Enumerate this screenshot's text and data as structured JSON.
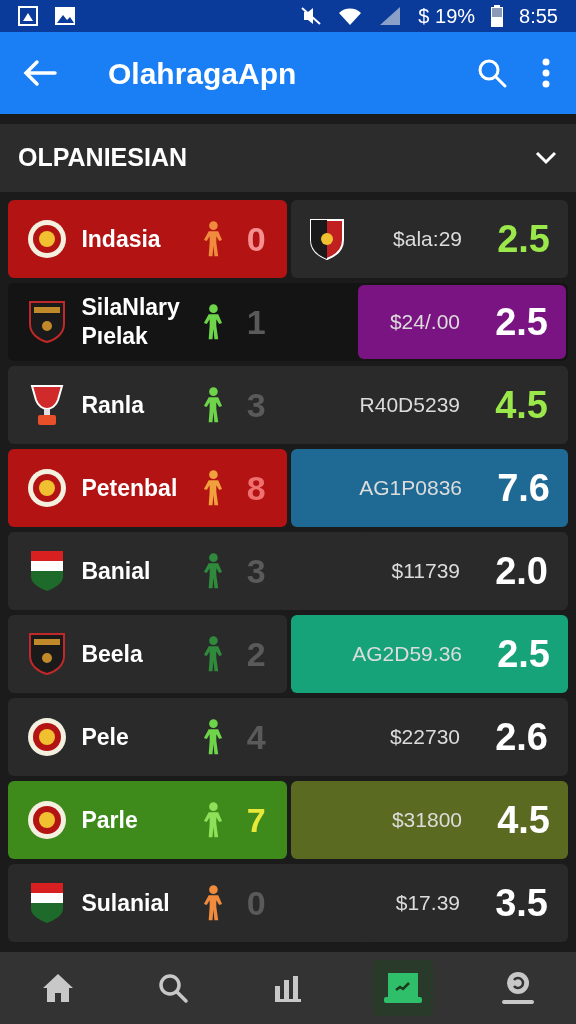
{
  "status_bar": {
    "battery": "$ 19%",
    "time": "8:55"
  },
  "app_bar": {
    "title": "OlahragaApn"
  },
  "section": {
    "title": "OLPANIESIAN"
  },
  "rows": [
    {
      "kind": "split",
      "crest": {
        "kind": "round"
      },
      "team": {
        "name": "Indasia",
        "color": "#b31313"
      },
      "player": {
        "color": "#f08a3c"
      },
      "score": {
        "text": "0",
        "color": "#f59090"
      },
      "odds": {
        "badge": {
          "kind": "shield"
        },
        "code": "$ala:29",
        "color": "#2a2a2a"
      },
      "value": {
        "text": "2.5",
        "color": "#9be84a"
      }
    },
    {
      "kind": "joined",
      "crest": {
        "kind": "shield"
      },
      "team": {
        "name": "SilaNlary Pıelak",
        "color": "#141414"
      },
      "player": {
        "color": "#6ed44a"
      },
      "score": {
        "text": "1",
        "color": "#5a5a5a"
      },
      "odds": {
        "code": "$24/.00",
        "color": "#7a1482"
      },
      "value": {
        "text": "2.5",
        "color": "#ffffff"
      }
    },
    {
      "kind": "joined",
      "crest": {
        "kind": "trophy"
      },
      "team": {
        "name": "Ranla",
        "color": "#2a2a2a"
      },
      "player": {
        "color": "#6ed44a"
      },
      "score": {
        "text": "3",
        "color": "#5a5a5a"
      },
      "odds": {
        "code": "R40D5239",
        "color": "#2a2a2a"
      },
      "value": {
        "text": "4.5",
        "color": "#9be84a"
      }
    },
    {
      "kind": "split",
      "crest": {
        "kind": "round"
      },
      "team": {
        "name": "Petenbal",
        "color": "#b31313"
      },
      "player": {
        "color": "#f0a03c"
      },
      "score": {
        "text": "8",
        "color": "#f07070"
      },
      "odds": {
        "code": "AG1P0836",
        "color": "#1f6a94"
      },
      "value": {
        "text": "7.6",
        "color": "#ffffff"
      }
    },
    {
      "kind": "joined",
      "crest": {
        "kind": "flag"
      },
      "team": {
        "name": "Banial",
        "color": "#2a2a2a"
      },
      "player": {
        "color": "#2f8a3c"
      },
      "score": {
        "text": "3",
        "color": "#5a5a5a"
      },
      "odds": {
        "code": "$11739",
        "color": "#2a2a2a"
      },
      "value": {
        "text": "2.0",
        "color": "#ffffff"
      }
    },
    {
      "kind": "split",
      "crest": {
        "kind": "shield"
      },
      "team": {
        "name": "Beela",
        "color": "#2a2a2a"
      },
      "player": {
        "color": "#2f8a3c"
      },
      "score": {
        "text": "2",
        "color": "#5a5a5a"
      },
      "odds": {
        "code": "AG2D59.36",
        "color": "#17a37a"
      },
      "value": {
        "text": "2.5",
        "color": "#ffffff"
      }
    },
    {
      "kind": "joined",
      "crest": {
        "kind": "round"
      },
      "team": {
        "name": "Pele",
        "color": "#2a2a2a"
      },
      "player": {
        "color": "#6ed44a"
      },
      "score": {
        "text": "4",
        "color": "#5a5a5a"
      },
      "odds": {
        "code": "$22730",
        "color": "#2a2a2a"
      },
      "value": {
        "text": "2.6",
        "color": "#ffffff"
      }
    },
    {
      "kind": "split",
      "crest": {
        "kind": "round"
      },
      "team": {
        "name": "Parle",
        "color": "#3e8a1a"
      },
      "player": {
        "color": "#8ee05a"
      },
      "score": {
        "text": "7",
        "color": "#e8e83a"
      },
      "odds": {
        "code": "$31800",
        "color": "#5a6a20"
      },
      "value": {
        "text": "4.5",
        "color": "#ffffff"
      }
    },
    {
      "kind": "joined",
      "crest": {
        "kind": "flag"
      },
      "team": {
        "name": "Sulanial",
        "color": "#2a2a2a"
      },
      "player": {
        "color": "#f08a3c"
      },
      "score": {
        "text": "0",
        "color": "#5a5a5a"
      },
      "odds": {
        "code": "$17.39",
        "color": "#2a2a2a"
      },
      "value": {
        "text": "3.5",
        "color": "#ffffff"
      }
    }
  ],
  "nav": [
    {
      "kind": "home",
      "selected": false
    },
    {
      "kind": "search",
      "selected": false
    },
    {
      "kind": "stats",
      "selected": false
    },
    {
      "kind": "board",
      "selected": true
    },
    {
      "kind": "profile",
      "selected": false
    }
  ]
}
